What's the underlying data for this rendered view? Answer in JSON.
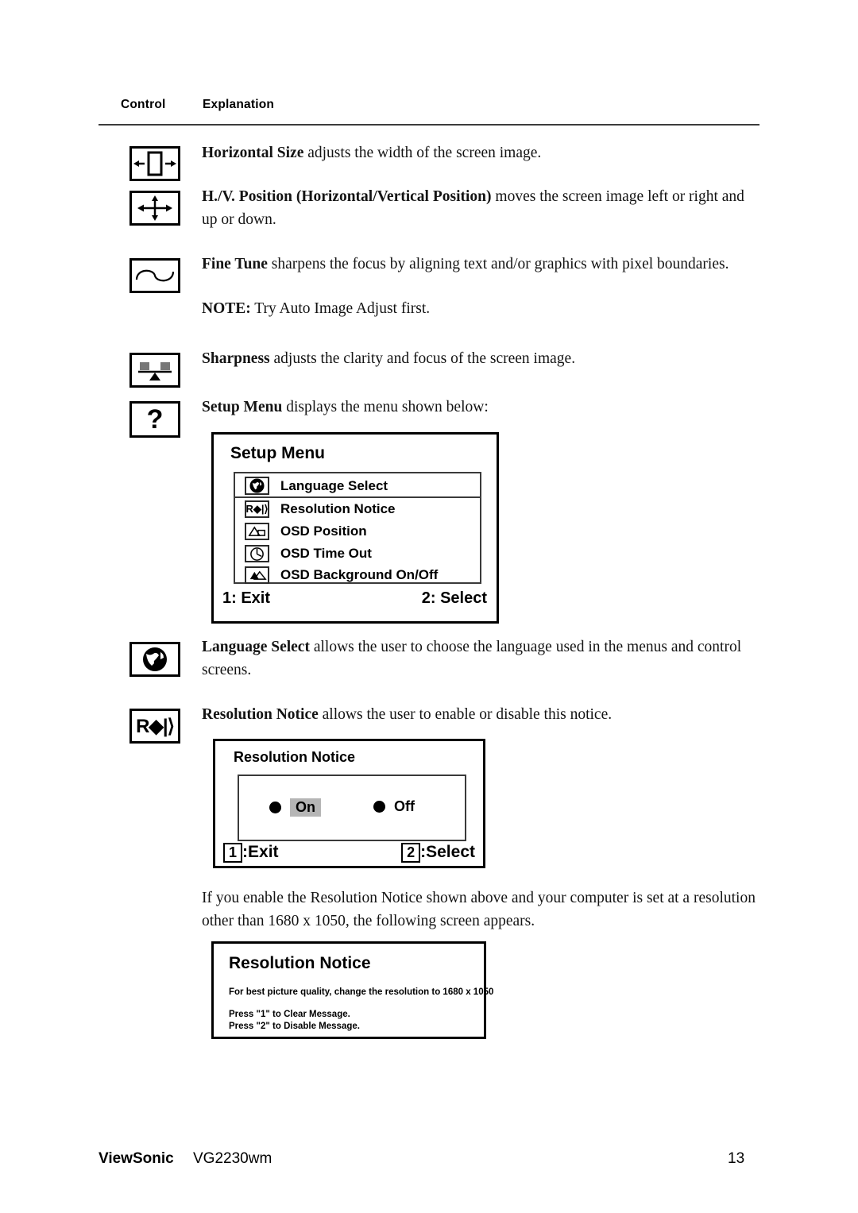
{
  "page": {
    "table_header": {
      "control": "Control",
      "explanation": "Explanation"
    },
    "footer": {
      "brand": "ViewSonic",
      "model": "VG2230wm",
      "page_number": "13"
    }
  },
  "entries": [
    {
      "icon": "horizontal-size-icon",
      "term": "Horizontal Size",
      "text": " adjusts the width of the screen image."
    },
    {
      "icon": "hv-position-icon",
      "term": "H./V. Position (Horizontal/Vertical Position)",
      "text": " moves the screen image left or right and up or down."
    },
    {
      "icon": "fine-tune-icon",
      "term": "Fine Tune",
      "text": " sharpens the focus by aligning text and/or graphics with pixel boundaries.",
      "note_term": "NOTE:",
      "note_text": " Try Auto Image Adjust first."
    },
    {
      "icon": "sharpness-icon",
      "term": "Sharpness",
      "text": " adjusts the clarity and focus of the screen image."
    },
    {
      "icon": "setup-menu-icon",
      "term": "Setup Menu",
      "text": " displays the menu shown below:"
    },
    {
      "icon": "language-select-icon",
      "term": "Language Select",
      "text": " allows the user to choose the language used in the menus and control screens."
    },
    {
      "icon": "resolution-notice-icon",
      "term": "Resolution Notice",
      "text": " allows the user to enable or disable this notice."
    }
  ],
  "setup_menu_osd": {
    "title": "Setup Menu",
    "items": [
      {
        "icon": "globe-icon",
        "label": "Language Select"
      },
      {
        "icon": "resolution-notice-icon",
        "label": "Resolution Notice"
      },
      {
        "icon": "osd-position-icon",
        "label": "OSD Position"
      },
      {
        "icon": "clock-icon",
        "label": "OSD Time Out"
      },
      {
        "icon": "osd-background-icon",
        "label": "OSD Background On/Off"
      }
    ],
    "footer_left": "1: Exit",
    "footer_right": "2: Select"
  },
  "resolution_notice_osd": {
    "title": "Resolution Notice",
    "options": [
      {
        "label": "On",
        "selected": true
      },
      {
        "label": "Off",
        "selected": false
      }
    ],
    "footer_left_key": "1",
    "footer_left_label": ":Exit",
    "footer_right_key": "2",
    "footer_right_label": ":Select"
  },
  "intermediate_paragraph": "If you enable the Resolution Notice shown above and your computer is set at a resolution other than 1680 x 1050, the following screen appears.",
  "resolution_message_osd": {
    "title": "Resolution Notice",
    "body": "For best picture quality, change the resolution to 1680 x 1050",
    "line1": "Press \"1\" to Clear Message.",
    "line2": "Press \"2\" to Disable Message."
  },
  "colors": {
    "ink": "#000000",
    "rule": "#3c3c3c",
    "highlight": "#b5b5b5",
    "paper": "#ffffff"
  }
}
